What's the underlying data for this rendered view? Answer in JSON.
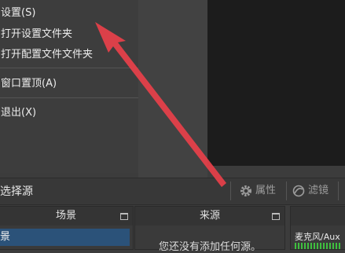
{
  "menu": {
    "items": [
      {
        "label": "设置(S)"
      },
      {
        "label": "打开设置文件夹"
      },
      {
        "label": "打开配置文件文件夹"
      },
      {
        "label": "窗口置顶(A)"
      },
      {
        "label": "退出(X)"
      }
    ]
  },
  "toolbar": {
    "select_source": "选择源",
    "properties_label": "属性",
    "filters_label": "滤镜"
  },
  "scenes": {
    "title": "场景",
    "items": [
      {
        "label": "景"
      }
    ]
  },
  "sources": {
    "title": "来源",
    "empty_text": "您还没有添加任何源。"
  },
  "mixer": {
    "channel_label": "麦克风/Aux"
  },
  "colors": {
    "annotation_arrow": "#e8404a",
    "selection": "#2b5279",
    "meter_green": "#3fbf3f"
  }
}
